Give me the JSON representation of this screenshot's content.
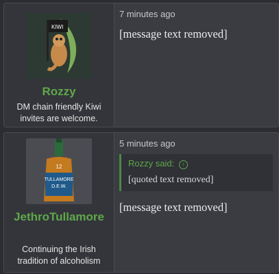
{
  "posts": [
    {
      "username": "Rozzy",
      "signature": "DM chain friendly Kiwi invites are welcome.",
      "timestamp": "7 minutes ago",
      "message": "[message text removed]",
      "avatar_flag_text": "KIWI"
    },
    {
      "username": "JethroTullamore",
      "signature": "Continuing the Irish tradition of alcoholism",
      "timestamp": "5 minutes ago",
      "quote_header": "Rozzy said:",
      "quote_text": "[quoted text removed]",
      "message": "[message text removed]",
      "avatar_label_1": "TULLAMORE",
      "avatar_label_2": "D.E.W.",
      "avatar_label_3": "12"
    }
  ],
  "colors": {
    "username": "#5fa84a",
    "quote_bar": "#4a8a45",
    "bg": "#2b2d31"
  }
}
